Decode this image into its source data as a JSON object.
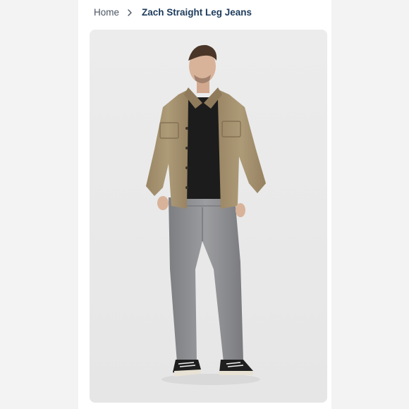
{
  "breadcrumb": {
    "home_label": "Home",
    "separator_icon": "chevron-right-icon",
    "current_label": "Zach Straight Leg Jeans"
  },
  "product_image": {
    "description_icon": "product-photo",
    "colors": {
      "background": "#ebebeb",
      "shirt": "#a89472",
      "tee": "#1c1c1c",
      "jeans": "#8f9093",
      "shoes": "#222222",
      "accent": "#1d3b5c"
    }
  }
}
